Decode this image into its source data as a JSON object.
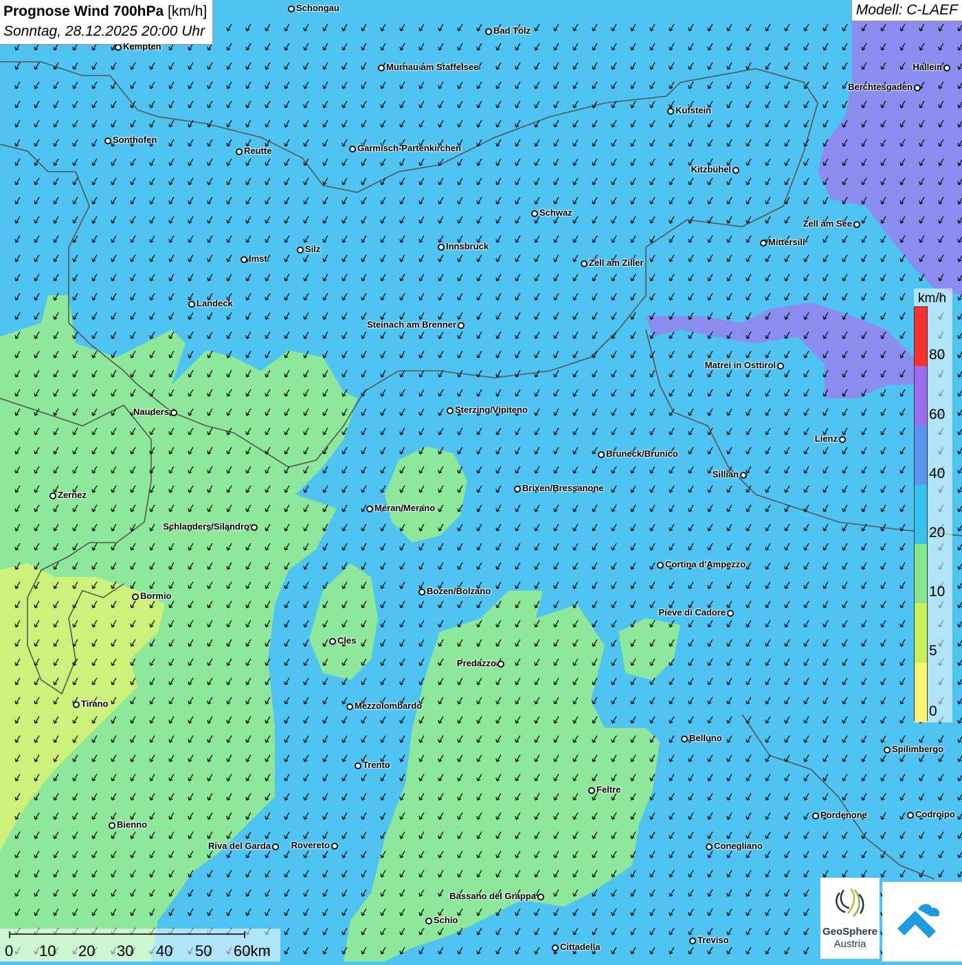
{
  "header": {
    "title": "Prognose Wind 700hPa",
    "unit": "[km/h]",
    "datetime": "Sonntag, 28.12.2025 20:00 Uhr"
  },
  "model": {
    "label": "Modell: C-LAEF"
  },
  "legend": {
    "unit": "km/h",
    "ticks": [
      "80",
      "60",
      "40",
      "20",
      "10",
      "5",
      "0"
    ],
    "colors": [
      "#ff3030",
      "#9b6df2",
      "#5a96f0",
      "#34c4ee",
      "#86e88e",
      "#c8f05a",
      "#fdf572"
    ]
  },
  "scale_bar": {
    "labels": [
      "0",
      "10",
      "20",
      "30",
      "40",
      "50",
      "60km"
    ]
  },
  "logos": {
    "geosphere_line1": "GeoSphere",
    "geosphere_line2": "Austria"
  },
  "map_colors": {
    "sea_blue": "#4fc3f2",
    "green_zone": "#8ee89b",
    "yellow_zone": "#cdf27b",
    "purple_zone": "#8a8cf0",
    "border": "#555555"
  },
  "cities": [
    {
      "name": "Schongau"
    },
    {
      "name": "Bad Tölz"
    },
    {
      "name": "Kempten"
    },
    {
      "name": "Murnau am Staffelsee"
    },
    {
      "name": "Hallein"
    },
    {
      "name": "Berchtesgaden"
    },
    {
      "name": "Kufstein"
    },
    {
      "name": "Sonthofen"
    },
    {
      "name": "Reutte"
    },
    {
      "name": "Garmisch-Partenkirchen"
    },
    {
      "name": "Kitzbühel"
    },
    {
      "name": "Schwaz"
    },
    {
      "name": "Zell am See"
    },
    {
      "name": "Mittersill"
    },
    {
      "name": "Silz"
    },
    {
      "name": "Innsbruck"
    },
    {
      "name": "Imst"
    },
    {
      "name": "Zell am Ziller"
    },
    {
      "name": "Landeck"
    },
    {
      "name": "Steinach am Brenner"
    },
    {
      "name": "Matrei in Osttirol"
    },
    {
      "name": "Nauders"
    },
    {
      "name": "Sterzing/Vipiteno"
    },
    {
      "name": "Lienz"
    },
    {
      "name": "Bruneck/Brunico"
    },
    {
      "name": "Sillian"
    },
    {
      "name": "Brixen/Bressanone"
    },
    {
      "name": "Zernez"
    },
    {
      "name": "Meran/Merano"
    },
    {
      "name": "Schlanders/Silandro"
    },
    {
      "name": "Cortina d'Ampezzo"
    },
    {
      "name": "Bozen/Bolzano"
    },
    {
      "name": "Bormio"
    },
    {
      "name": "Pieve di Cadore"
    },
    {
      "name": "Cles"
    },
    {
      "name": "Predazzo"
    },
    {
      "name": "Tirano"
    },
    {
      "name": "Mezzolombardo"
    },
    {
      "name": "Belluno"
    },
    {
      "name": "Spilimbergo"
    },
    {
      "name": "Trento"
    },
    {
      "name": "Feltre"
    },
    {
      "name": "Pordenone"
    },
    {
      "name": "Codroipo"
    },
    {
      "name": "Bienno"
    },
    {
      "name": "Riva del Garda"
    },
    {
      "name": "Rovereto"
    },
    {
      "name": "Conegliano"
    },
    {
      "name": "Bassano del Grappa"
    },
    {
      "name": "Schio"
    },
    {
      "name": "Treviso"
    },
    {
      "name": "Cittadella"
    }
  ]
}
